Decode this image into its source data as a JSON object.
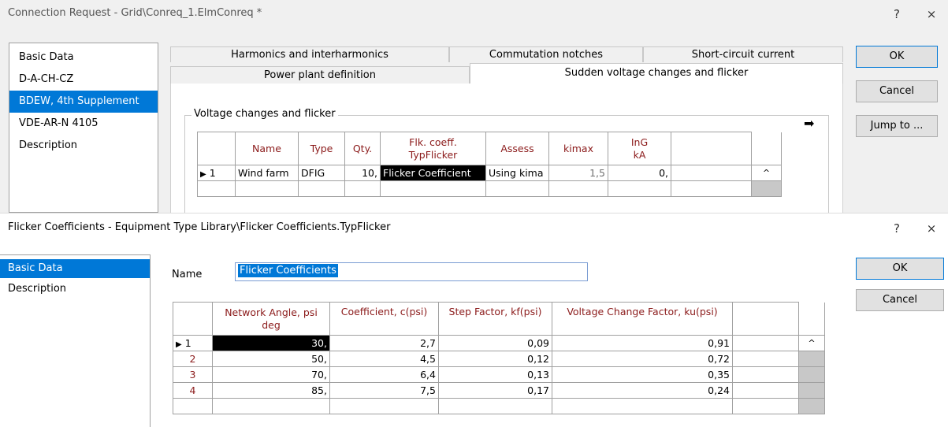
{
  "win1": {
    "title": "Connection Request - Grid\\Conreq_1.ElmConreq *",
    "help": "?",
    "close": "×",
    "nav": [
      "Basic Data",
      "D-A-CH-CZ",
      "BDEW, 4th Supplement",
      "VDE-AR-N 4105",
      "Description"
    ],
    "nav_selected": 2,
    "tabs_row1": [
      "Harmonics and interharmonics",
      "Commutation notches",
      "Short-circuit current"
    ],
    "tabs_row2": [
      "Power plant definition",
      "Sudden voltage changes and flicker"
    ],
    "group_title": "Voltage changes and flicker",
    "columns": [
      {
        "line1": "Name",
        "line2": ""
      },
      {
        "line1": "Type",
        "line2": ""
      },
      {
        "line1": "Qty.",
        "line2": ""
      },
      {
        "line1": "Flk. coeff.",
        "line2": "TypFlicker"
      },
      {
        "line1": "Assess",
        "line2": ""
      },
      {
        "line1": "kimax",
        "line2": ""
      },
      {
        "line1": "InG",
        "line2": "kA"
      }
    ],
    "rows": [
      {
        "idx": "1",
        "name": "Wind farm",
        "type": "DFIG",
        "qty": "10,",
        "coeff": "Flicker Coefficient",
        "assess": "Using kima",
        "kimax": "1,5",
        "ing": "0,"
      }
    ],
    "buttons": {
      "ok": "OK",
      "cancel": "Cancel",
      "jump": "Jump to ..."
    },
    "accent": "#0078d7"
  },
  "win2": {
    "title": "Flicker Coefficients - Equipment Type Library\\Flicker Coefficients.TypFlicker",
    "help": "?",
    "close": "×",
    "nav": [
      "Basic Data",
      "Description"
    ],
    "nav_selected": 0,
    "name_label": "Name",
    "name_value": "Flicker Coefficients",
    "columns": [
      {
        "line1": "Network Angle, psi",
        "line2": "deg"
      },
      {
        "line1": "Coefficient, c(psi)",
        "line2": ""
      },
      {
        "line1": "Step Factor, kf(psi)",
        "line2": ""
      },
      {
        "line1": "Voltage Change Factor, ku(psi)",
        "line2": ""
      }
    ],
    "rows": [
      {
        "idx": "1",
        "angle": "30,",
        "coeff": "2,7",
        "kf": "0,09",
        "ku": "0,91"
      },
      {
        "idx": "2",
        "angle": "50,",
        "coeff": "4,5",
        "kf": "0,12",
        "ku": "0,72"
      },
      {
        "idx": "3",
        "angle": "70,",
        "coeff": "6,4",
        "kf": "0,13",
        "ku": "0,35"
      },
      {
        "idx": "4",
        "angle": "85,",
        "coeff": "7,5",
        "kf": "0,17",
        "ku": "0,24"
      }
    ],
    "buttons": {
      "ok": "OK",
      "cancel": "Cancel"
    }
  }
}
